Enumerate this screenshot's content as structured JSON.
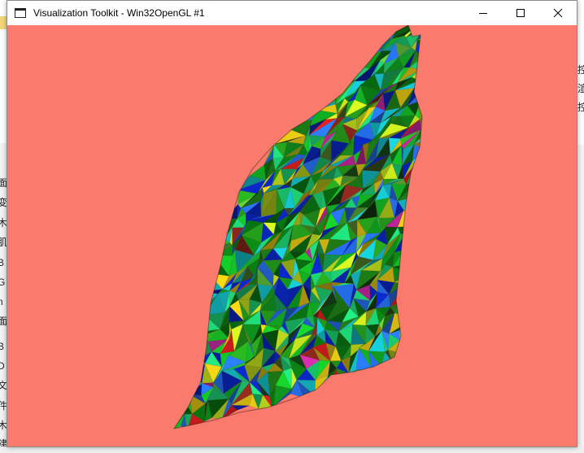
{
  "window": {
    "title": "Visualization Toolkit - Win32OpenGL #1",
    "controls": {
      "minimize_icon": "minimize-icon",
      "maximize_icon": "maximize-icon",
      "close_icon": "close-icon"
    }
  },
  "viewport": {
    "background_color": "#fa7b6e",
    "content": "rendered 3D terrain surface"
  },
  "background_fragments": {
    "left": [
      "面",
      "变",
      "木",
      "肌",
      "B",
      "G",
      "n",
      "面",
      "B",
      "D",
      "文",
      "件",
      "木",
      "建"
    ],
    "right": [
      "控",
      "渲",
      "控"
    ]
  }
}
